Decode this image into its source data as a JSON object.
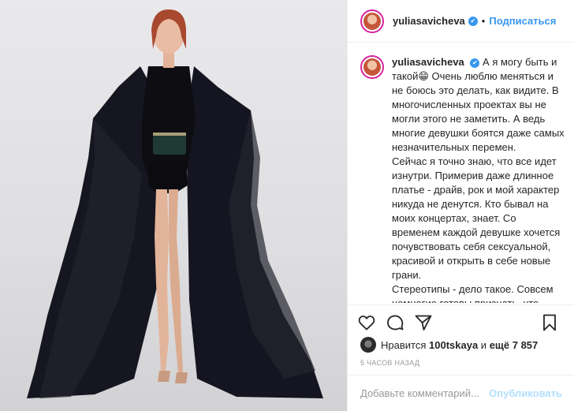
{
  "post": {
    "username": "yuliasavicheva",
    "follow_label": "Подписаться",
    "dot": "•",
    "verified_glyph": "✔",
    "caption": [
      "А я могу быть и такой😁 Очень люблю меняться и не боюсь это делать, как видите. В многочисленных проектах вы не могли этого не заметить. А ведь многие девушки боятся даже самых незначительных перемен.",
      "Сейчас я точно знаю, что все идет изнутри. Примерив даже длинное платье - драйв, рок и мой характер никуда не денутся. Кто бывал на моих концертах, знает. Со временем каждой девушке хочется почувствовать себя сексуальной, красивой и открыть в себе новые грани.",
      "Стереотипы - дело такое. Совсем немногие готовы признать, что заблуждались или что-то могло"
    ],
    "likes_prefix": "Нравится",
    "likes_user": "100tskaya",
    "likes_mid": "и",
    "likes_more": "ещё 7 857",
    "time_ago": "5 часов назад",
    "comment_placeholder": "Добавьте комментарий...",
    "publish_label": "Опубликовать"
  },
  "colors": {
    "accent": "#3897f0",
    "muted": "#999999",
    "publish_disabled": "#b2dffc"
  },
  "icons": {
    "like": "heart-icon",
    "comment": "comment-icon",
    "share": "share-icon",
    "save": "bookmark-icon"
  }
}
